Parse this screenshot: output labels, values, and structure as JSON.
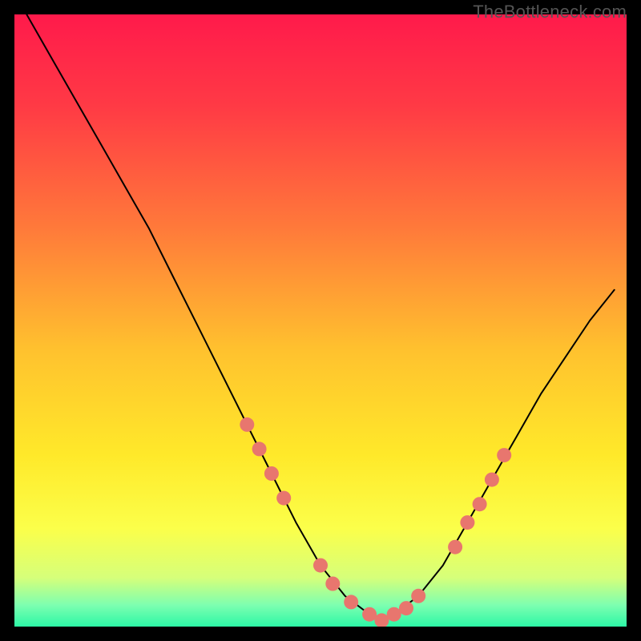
{
  "watermark": "TheBottleneck.com",
  "chart_data": {
    "type": "line",
    "title": "",
    "xlabel": "",
    "ylabel": "",
    "xlim": [
      0,
      100
    ],
    "ylim": [
      0,
      100
    ],
    "grid": false,
    "legend": false,
    "background_gradient": {
      "stops": [
        {
          "offset": 0.0,
          "color": "#ff1a4b"
        },
        {
          "offset": 0.15,
          "color": "#ff3a45"
        },
        {
          "offset": 0.35,
          "color": "#ff7a3a"
        },
        {
          "offset": 0.55,
          "color": "#ffc22e"
        },
        {
          "offset": 0.72,
          "color": "#ffe92a"
        },
        {
          "offset": 0.84,
          "color": "#fbff4a"
        },
        {
          "offset": 0.92,
          "color": "#d6ff7a"
        },
        {
          "offset": 0.965,
          "color": "#7dffb0"
        },
        {
          "offset": 1.0,
          "color": "#2cf7a6"
        }
      ]
    },
    "series": [
      {
        "name": "bottleneck-curve",
        "color": "#000000",
        "stroke_width": 2,
        "x": [
          2,
          6,
          10,
          14,
          18,
          22,
          26,
          30,
          34,
          38,
          42,
          46,
          50,
          54,
          58,
          60,
          62,
          66,
          70,
          74,
          78,
          82,
          86,
          90,
          94,
          98
        ],
        "y": [
          100,
          93,
          86,
          79,
          72,
          65,
          57,
          49,
          41,
          33,
          25,
          17,
          10,
          5,
          2,
          1,
          2,
          5,
          10,
          17,
          24,
          31,
          38,
          44,
          50,
          55
        ]
      }
    ],
    "markers": {
      "name": "highlight-dots",
      "color": "#e8766e",
      "radius": 9,
      "points": [
        {
          "x": 38,
          "y": 33
        },
        {
          "x": 40,
          "y": 29
        },
        {
          "x": 42,
          "y": 25
        },
        {
          "x": 44,
          "y": 21
        },
        {
          "x": 50,
          "y": 10
        },
        {
          "x": 52,
          "y": 7
        },
        {
          "x": 55,
          "y": 4
        },
        {
          "x": 58,
          "y": 2
        },
        {
          "x": 60,
          "y": 1
        },
        {
          "x": 62,
          "y": 2
        },
        {
          "x": 64,
          "y": 3
        },
        {
          "x": 66,
          "y": 5
        },
        {
          "x": 72,
          "y": 13
        },
        {
          "x": 74,
          "y": 17
        },
        {
          "x": 76,
          "y": 20
        },
        {
          "x": 78,
          "y": 24
        },
        {
          "x": 80,
          "y": 28
        }
      ]
    }
  }
}
